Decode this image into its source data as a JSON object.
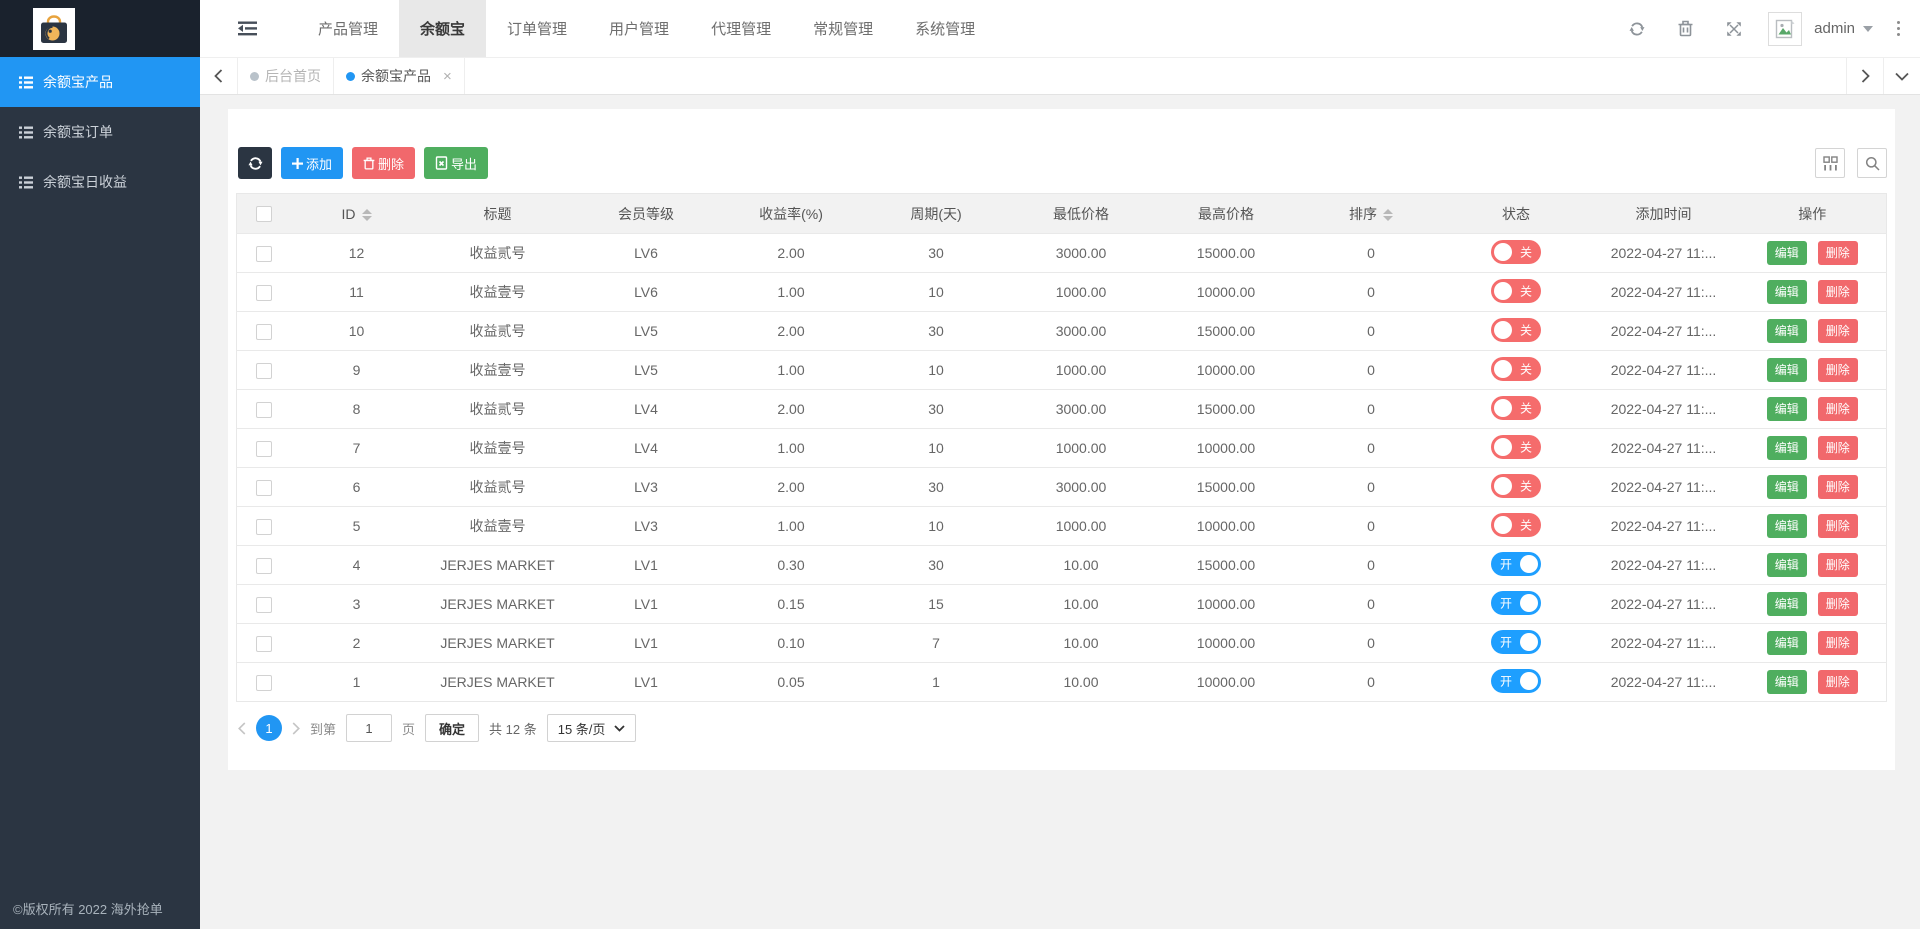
{
  "accent": "#2196f3",
  "sidebar": {
    "items": [
      {
        "label": "余额宝产品",
        "active": true
      },
      {
        "label": "余额宝订单",
        "active": false
      },
      {
        "label": "余额宝日收益",
        "active": false
      }
    ],
    "footer": "©版权所有 2022 海外抢单"
  },
  "navbar": {
    "items": [
      {
        "label": "产品管理",
        "active": false
      },
      {
        "label": "余额宝",
        "active": true
      },
      {
        "label": "订单管理",
        "active": false
      },
      {
        "label": "用户管理",
        "active": false
      },
      {
        "label": "代理管理",
        "active": false
      },
      {
        "label": "常规管理",
        "active": false
      },
      {
        "label": "系统管理",
        "active": false
      }
    ],
    "user": "admin"
  },
  "tabs": [
    {
      "label": "后台首页",
      "active": false,
      "closable": false
    },
    {
      "label": "余额宝产品",
      "active": true,
      "closable": true
    }
  ],
  "toolbar": {
    "add_label": "添加",
    "delete_label": "删除",
    "export_label": "导出"
  },
  "table": {
    "columns": [
      {
        "label": "ID",
        "sortable": true
      },
      {
        "label": "标题",
        "sortable": false
      },
      {
        "label": "会员等级",
        "sortable": false
      },
      {
        "label": "收益率(%)",
        "sortable": false
      },
      {
        "label": "周期(天)",
        "sortable": false
      },
      {
        "label": "最低价格",
        "sortable": false
      },
      {
        "label": "最高价格",
        "sortable": false
      },
      {
        "label": "排序",
        "sortable": true
      },
      {
        "label": "状态",
        "sortable": false
      },
      {
        "label": "添加时间",
        "sortable": false
      },
      {
        "label": "操作",
        "sortable": false
      }
    ],
    "on_label": "开",
    "off_label": "关",
    "edit_label": "编辑",
    "delete_label": "删除",
    "rows": [
      {
        "id": "12",
        "title": "收益贰号",
        "level": "LV6",
        "rate": "2.00",
        "period": "30",
        "min": "3000.00",
        "max": "15000.00",
        "sort": "0",
        "status": "off",
        "time": "2022-04-27 11:..."
      },
      {
        "id": "11",
        "title": "收益壹号",
        "level": "LV6",
        "rate": "1.00",
        "period": "10",
        "min": "1000.00",
        "max": "10000.00",
        "sort": "0",
        "status": "off",
        "time": "2022-04-27 11:..."
      },
      {
        "id": "10",
        "title": "收益贰号",
        "level": "LV5",
        "rate": "2.00",
        "period": "30",
        "min": "3000.00",
        "max": "15000.00",
        "sort": "0",
        "status": "off",
        "time": "2022-04-27 11:..."
      },
      {
        "id": "9",
        "title": "收益壹号",
        "level": "LV5",
        "rate": "1.00",
        "period": "10",
        "min": "1000.00",
        "max": "10000.00",
        "sort": "0",
        "status": "off",
        "time": "2022-04-27 11:..."
      },
      {
        "id": "8",
        "title": "收益贰号",
        "level": "LV4",
        "rate": "2.00",
        "period": "30",
        "min": "3000.00",
        "max": "15000.00",
        "sort": "0",
        "status": "off",
        "time": "2022-04-27 11:..."
      },
      {
        "id": "7",
        "title": "收益壹号",
        "level": "LV4",
        "rate": "1.00",
        "period": "10",
        "min": "1000.00",
        "max": "10000.00",
        "sort": "0",
        "status": "off",
        "time": "2022-04-27 11:..."
      },
      {
        "id": "6",
        "title": "收益贰号",
        "level": "LV3",
        "rate": "2.00",
        "period": "30",
        "min": "3000.00",
        "max": "15000.00",
        "sort": "0",
        "status": "off",
        "time": "2022-04-27 11:..."
      },
      {
        "id": "5",
        "title": "收益壹号",
        "level": "LV3",
        "rate": "1.00",
        "period": "10",
        "min": "1000.00",
        "max": "10000.00",
        "sort": "0",
        "status": "off",
        "time": "2022-04-27 11:..."
      },
      {
        "id": "4",
        "title": "JERJES MARKET",
        "level": "LV1",
        "rate": "0.30",
        "period": "30",
        "min": "10.00",
        "max": "15000.00",
        "sort": "0",
        "status": "on",
        "time": "2022-04-27 11:..."
      },
      {
        "id": "3",
        "title": "JERJES MARKET",
        "level": "LV1",
        "rate": "0.15",
        "period": "15",
        "min": "10.00",
        "max": "10000.00",
        "sort": "0",
        "status": "on",
        "time": "2022-04-27 11:..."
      },
      {
        "id": "2",
        "title": "JERJES MARKET",
        "level": "LV1",
        "rate": "0.10",
        "period": "7",
        "min": "10.00",
        "max": "10000.00",
        "sort": "0",
        "status": "on",
        "time": "2022-04-27 11:..."
      },
      {
        "id": "1",
        "title": "JERJES MARKET",
        "level": "LV1",
        "rate": "0.05",
        "period": "1",
        "min": "10.00",
        "max": "10000.00",
        "sort": "0",
        "status": "on",
        "time": "2022-04-27 11:..."
      }
    ]
  },
  "pagination": {
    "page": "1",
    "goto_label": "到第",
    "page_unit": "页",
    "confirm_label": "确定",
    "total_label": "共 12 条",
    "per_page": "15 条/页"
  }
}
